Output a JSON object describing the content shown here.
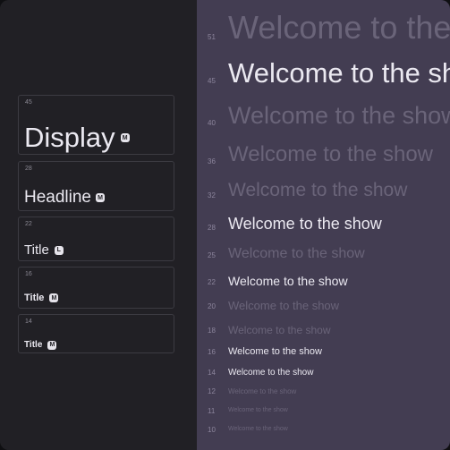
{
  "cards": [
    {
      "size": "45",
      "label": "Display",
      "badge": "M"
    },
    {
      "size": "28",
      "label": "Headline",
      "badge": "M"
    },
    {
      "size": "22",
      "label": "Title",
      "badge": "L"
    },
    {
      "size": "16",
      "label": "Title",
      "badge": "M"
    },
    {
      "size": "14",
      "label": "Title",
      "badge": "M"
    }
  ],
  "rows": [
    {
      "size": "51",
      "text": "Welcome to the show"
    },
    {
      "size": "45",
      "text": "Welcome to the show"
    },
    {
      "size": "40",
      "text": "Welcome to the show"
    },
    {
      "size": "36",
      "text": "Welcome to the show"
    },
    {
      "size": "32",
      "text": "Welcome to the show"
    },
    {
      "size": "28",
      "text": "Welcome to the show"
    },
    {
      "size": "25",
      "text": "Welcome to the show"
    },
    {
      "size": "22",
      "text": "Welcome to the show"
    },
    {
      "size": "20",
      "text": "Welcome to the show"
    },
    {
      "size": "18",
      "text": "Welcome to the show"
    },
    {
      "size": "16",
      "text": "Welcome to the show"
    },
    {
      "size": "14",
      "text": "Welcome to the show"
    },
    {
      "size": "12",
      "text": "Welcome to the show"
    },
    {
      "size": "11",
      "text": "Welcome to the show"
    },
    {
      "size": "10",
      "text": "Welcome to the show"
    }
  ],
  "colors": {
    "left_panel_bg": "#212025",
    "right_panel_bg": "#433d52",
    "text_bright": "#ebe9f1",
    "text_dim": "#6a6479"
  }
}
